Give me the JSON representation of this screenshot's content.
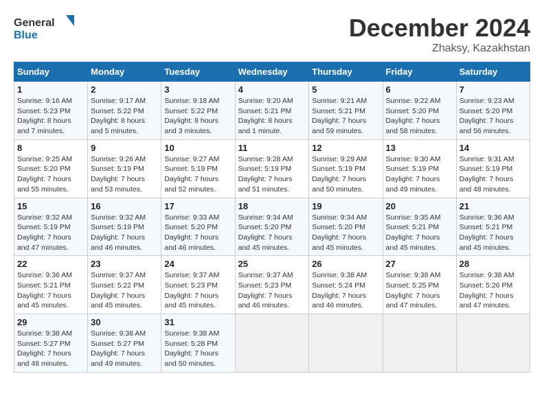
{
  "header": {
    "logo_line1": "General",
    "logo_line2": "Blue",
    "month": "December 2024",
    "location": "Zhaksy, Kazakhstan"
  },
  "weekdays": [
    "Sunday",
    "Monday",
    "Tuesday",
    "Wednesday",
    "Thursday",
    "Friday",
    "Saturday"
  ],
  "weeks": [
    [
      {
        "day": 1,
        "sunrise": "9:16 AM",
        "sunset": "5:23 PM",
        "daylight": "8 hours and 7 minutes."
      },
      {
        "day": 2,
        "sunrise": "9:17 AM",
        "sunset": "5:22 PM",
        "daylight": "8 hours and 5 minutes."
      },
      {
        "day": 3,
        "sunrise": "9:18 AM",
        "sunset": "5:22 PM",
        "daylight": "8 hours and 3 minutes."
      },
      {
        "day": 4,
        "sunrise": "9:20 AM",
        "sunset": "5:21 PM",
        "daylight": "8 hours and 1 minute."
      },
      {
        "day": 5,
        "sunrise": "9:21 AM",
        "sunset": "5:21 PM",
        "daylight": "7 hours and 59 minutes."
      },
      {
        "day": 6,
        "sunrise": "9:22 AM",
        "sunset": "5:20 PM",
        "daylight": "7 hours and 58 minutes."
      },
      {
        "day": 7,
        "sunrise": "9:23 AM",
        "sunset": "5:20 PM",
        "daylight": "7 hours and 56 minutes."
      }
    ],
    [
      {
        "day": 8,
        "sunrise": "9:25 AM",
        "sunset": "5:20 PM",
        "daylight": "7 hours and 55 minutes."
      },
      {
        "day": 9,
        "sunrise": "9:26 AM",
        "sunset": "5:19 PM",
        "daylight": "7 hours and 53 minutes."
      },
      {
        "day": 10,
        "sunrise": "9:27 AM",
        "sunset": "5:19 PM",
        "daylight": "7 hours and 52 minutes."
      },
      {
        "day": 11,
        "sunrise": "9:28 AM",
        "sunset": "5:19 PM",
        "daylight": "7 hours and 51 minutes."
      },
      {
        "day": 12,
        "sunrise": "9:29 AM",
        "sunset": "5:19 PM",
        "daylight": "7 hours and 50 minutes."
      },
      {
        "day": 13,
        "sunrise": "9:30 AM",
        "sunset": "5:19 PM",
        "daylight": "7 hours and 49 minutes."
      },
      {
        "day": 14,
        "sunrise": "9:31 AM",
        "sunset": "5:19 PM",
        "daylight": "7 hours and 48 minutes."
      }
    ],
    [
      {
        "day": 15,
        "sunrise": "9:32 AM",
        "sunset": "5:19 PM",
        "daylight": "7 hours and 47 minutes."
      },
      {
        "day": 16,
        "sunrise": "9:32 AM",
        "sunset": "5:19 PM",
        "daylight": "7 hours and 46 minutes."
      },
      {
        "day": 17,
        "sunrise": "9:33 AM",
        "sunset": "5:20 PM",
        "daylight": "7 hours and 46 minutes."
      },
      {
        "day": 18,
        "sunrise": "9:34 AM",
        "sunset": "5:20 PM",
        "daylight": "7 hours and 45 minutes."
      },
      {
        "day": 19,
        "sunrise": "9:34 AM",
        "sunset": "5:20 PM",
        "daylight": "7 hours and 45 minutes."
      },
      {
        "day": 20,
        "sunrise": "9:35 AM",
        "sunset": "5:21 PM",
        "daylight": "7 hours and 45 minutes."
      },
      {
        "day": 21,
        "sunrise": "9:36 AM",
        "sunset": "5:21 PM",
        "daylight": "7 hours and 45 minutes."
      }
    ],
    [
      {
        "day": 22,
        "sunrise": "9:36 AM",
        "sunset": "5:21 PM",
        "daylight": "7 hours and 45 minutes."
      },
      {
        "day": 23,
        "sunrise": "9:37 AM",
        "sunset": "5:22 PM",
        "daylight": "7 hours and 45 minutes."
      },
      {
        "day": 24,
        "sunrise": "9:37 AM",
        "sunset": "5:23 PM",
        "daylight": "7 hours and 45 minutes."
      },
      {
        "day": 25,
        "sunrise": "9:37 AM",
        "sunset": "5:23 PM",
        "daylight": "7 hours and 46 minutes."
      },
      {
        "day": 26,
        "sunrise": "9:38 AM",
        "sunset": "5:24 PM",
        "daylight": "7 hours and 46 minutes."
      },
      {
        "day": 27,
        "sunrise": "9:38 AM",
        "sunset": "5:25 PM",
        "daylight": "7 hours and 47 minutes."
      },
      {
        "day": 28,
        "sunrise": "9:38 AM",
        "sunset": "5:26 PM",
        "daylight": "7 hours and 47 minutes."
      }
    ],
    [
      {
        "day": 29,
        "sunrise": "9:38 AM",
        "sunset": "5:27 PM",
        "daylight": "7 hours and 48 minutes."
      },
      {
        "day": 30,
        "sunrise": "9:38 AM",
        "sunset": "5:27 PM",
        "daylight": "7 hours and 49 minutes."
      },
      {
        "day": 31,
        "sunrise": "9:38 AM",
        "sunset": "5:28 PM",
        "daylight": "7 hours and 50 minutes."
      },
      null,
      null,
      null,
      null
    ]
  ]
}
